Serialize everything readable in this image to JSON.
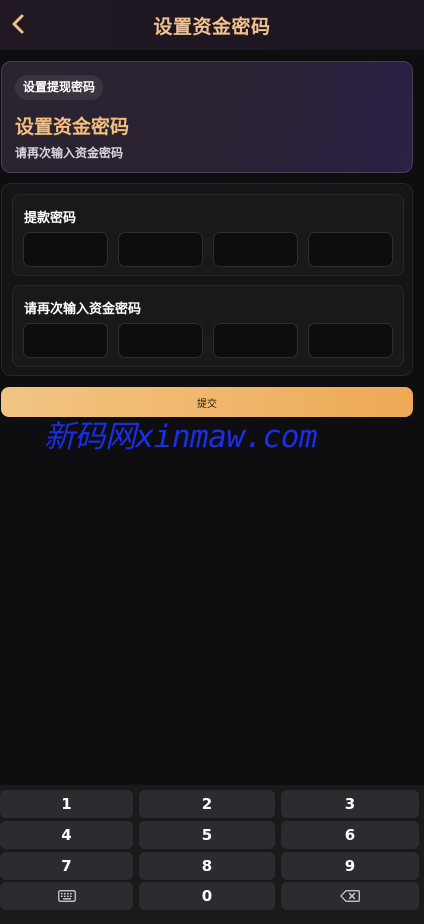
{
  "header": {
    "title": "设置资金密码",
    "back_icon": "chevron-left-icon"
  },
  "intro": {
    "tag": "设置提现密码",
    "title": "设置资金密码",
    "subtitle": "请再次输入资金密码"
  },
  "form": {
    "field1": {
      "label": "提款密码",
      "length": 4
    },
    "field2": {
      "label": "请再次输入资金密码",
      "length": 4
    }
  },
  "submit": {
    "label": "提交"
  },
  "watermark": "新码网xinmaw.com",
  "keypad": {
    "keys": [
      "1",
      "2",
      "3",
      "4",
      "5",
      "6",
      "7",
      "8",
      "9",
      "0"
    ],
    "hide_icon": "keyboard-icon",
    "delete_icon": "backspace-icon"
  },
  "colors": {
    "accent_gold": "#f3be7e",
    "button_gradient_start": "#f2c584",
    "button_gradient_end": "#eea957",
    "watermark": "#1a2ee8",
    "background": "#0e0e10"
  }
}
